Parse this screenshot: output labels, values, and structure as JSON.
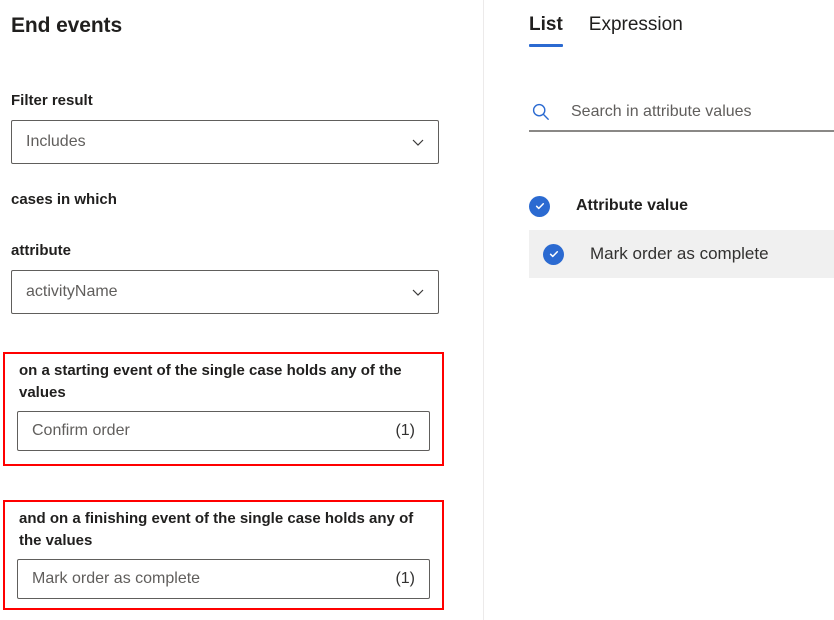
{
  "left": {
    "title": "End events",
    "filter": {
      "label": "Filter result",
      "value": "Includes",
      "chevron_icon": "chevron-down-icon"
    },
    "connector_text": "cases in which",
    "attribute": {
      "label": "attribute",
      "value": "activityName",
      "chevron_icon": "chevron-down-icon"
    },
    "start_condition": {
      "label": "on a starting event of the single case holds any of the values",
      "value": "Confirm order",
      "count": "(1)",
      "highlight_color": "#ff0000"
    },
    "end_condition": {
      "label": "and on a finishing event of the single case holds any of the values",
      "value": "Mark order as complete",
      "count": "(1)",
      "highlight_color": "#ff0000"
    }
  },
  "right": {
    "tabs": [
      {
        "label": "List",
        "active": true
      },
      {
        "label": "Expression",
        "active": false
      }
    ],
    "search": {
      "icon": "search-icon",
      "placeholder": "Search in attribute values",
      "value": "",
      "icon_color": "#2b6ad1"
    },
    "list": {
      "header": {
        "label": "Attribute value",
        "checked": true
      },
      "items": [
        {
          "label": "Mark order as complete",
          "checked": true,
          "selected": true
        }
      ]
    },
    "accent_color": "#2b6ad1"
  }
}
